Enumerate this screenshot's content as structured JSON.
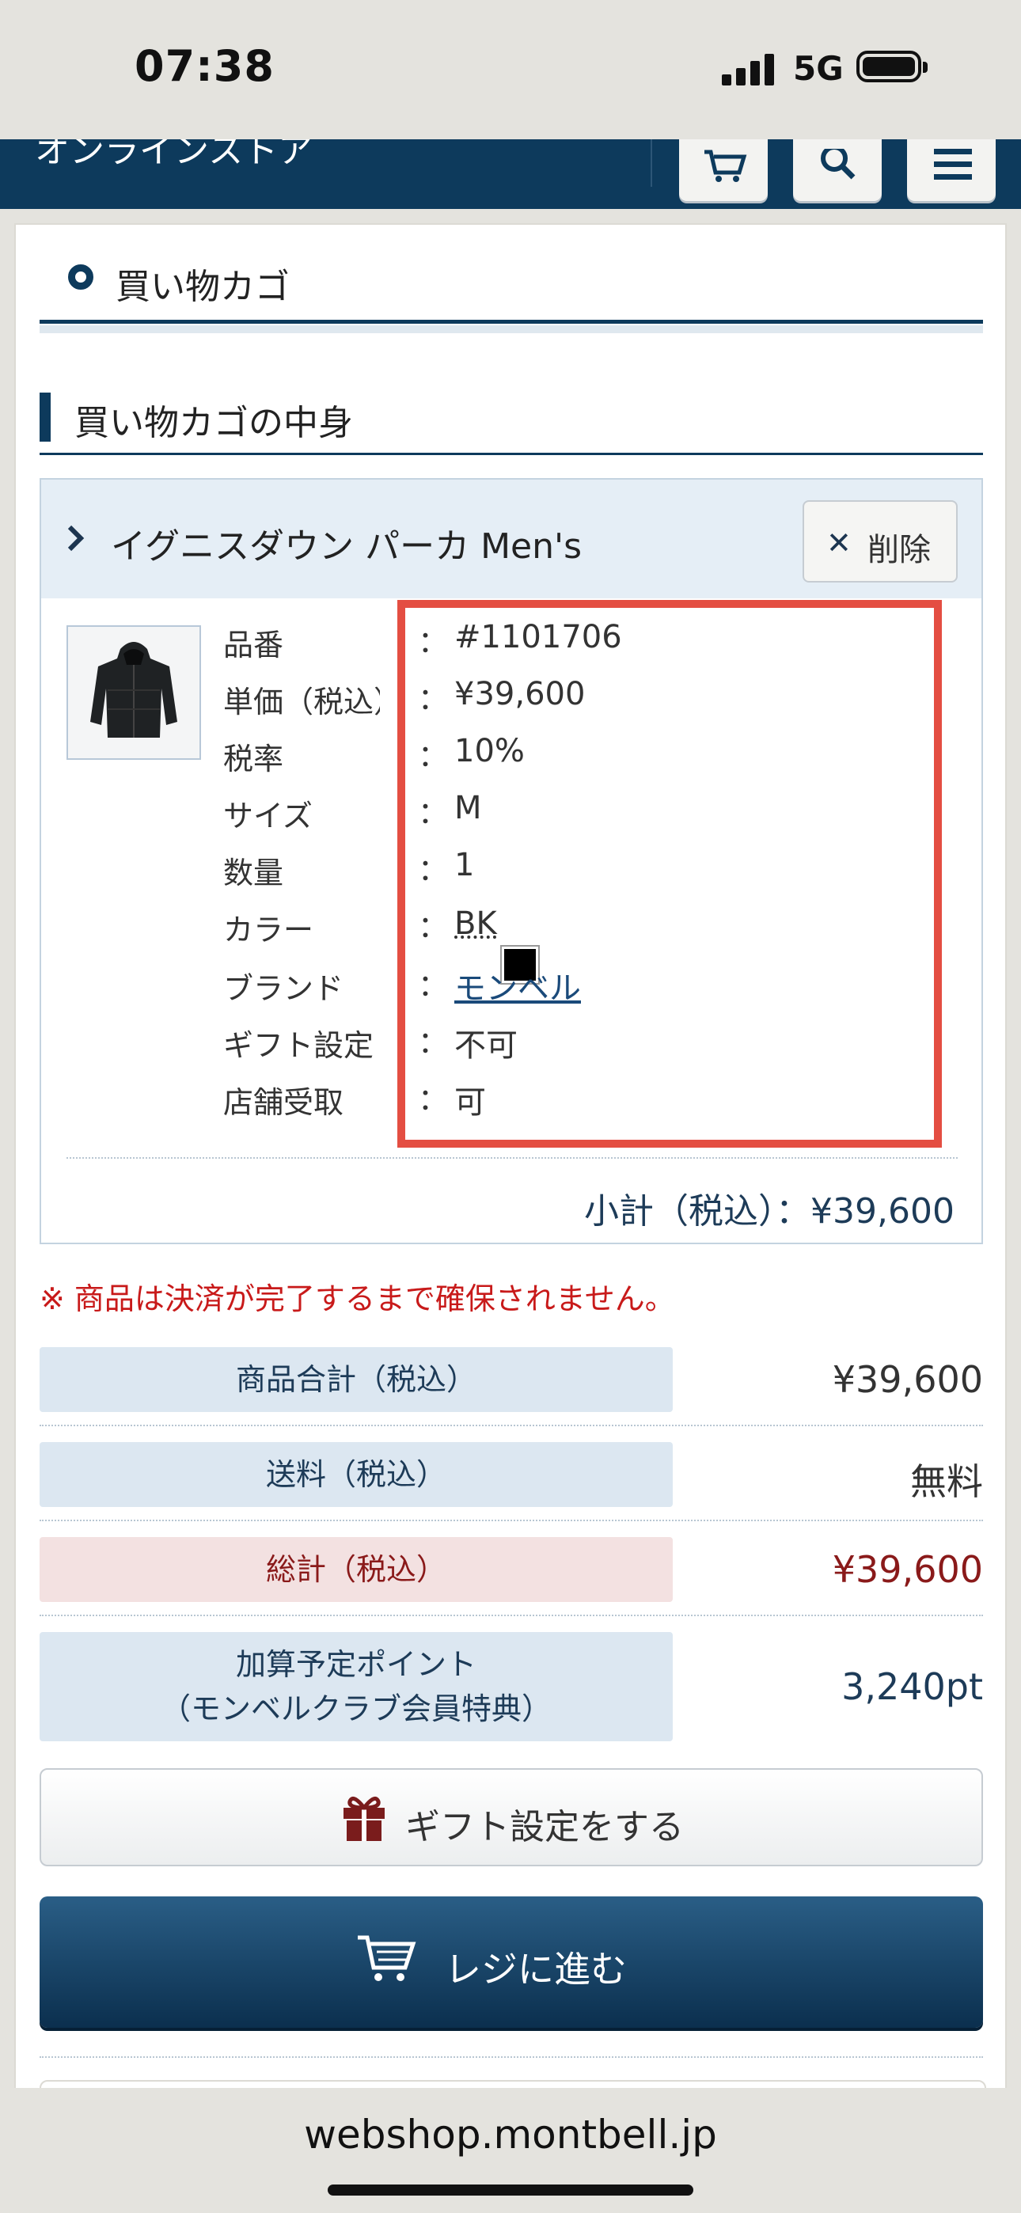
{
  "status_bar": {
    "time": "07:38",
    "network": "5G"
  },
  "header": {
    "store_name": "オンラインストア"
  },
  "page": {
    "title": "買い物カゴ",
    "section_title": "買い物カゴの中身"
  },
  "item": {
    "name": "イグニスダウン パーカ Men's",
    "delete_label": "削除",
    "details": [
      {
        "label": "品番",
        "value": "#1101706"
      },
      {
        "label": "単価（税込）",
        "value": "¥39,600"
      },
      {
        "label": "税率",
        "value": "10%"
      },
      {
        "label": "サイズ",
        "value": "M"
      },
      {
        "label": "数量",
        "value": "1"
      },
      {
        "label": "カラー",
        "value": "BK"
      },
      {
        "label": "ブランド",
        "value": "モンベル"
      },
      {
        "label": "ギフト設定",
        "value": "不可"
      },
      {
        "label": "店舗受取",
        "value": "可"
      }
    ],
    "colon": "：",
    "color_swatch": "#000000",
    "subtotal": "小計（税込）：¥39,600"
  },
  "notice": "※ 商品は決済が完了するまで確保されません。",
  "summary": {
    "items_total_label": "商品合計（税込）",
    "items_total_value": "¥39,600",
    "shipping_label": "送料（税込）",
    "shipping_value": "無料",
    "grand_total_label": "総計（税込）",
    "grand_total_value": "¥39,600",
    "points_label_1": "加算予定ポイント",
    "points_label_2": "（モンベルクラブ会員特典）",
    "points_value": "3,240pt"
  },
  "buttons": {
    "gift": "ギフト設定をする",
    "checkout": "レジに進む"
  },
  "browser": {
    "url": "webshop.montbell.jp"
  },
  "colors": {
    "brand": "#0d3a5c",
    "highlight": "#e44e42",
    "notice": "#c81a1a",
    "total": "#8a1a1a"
  }
}
